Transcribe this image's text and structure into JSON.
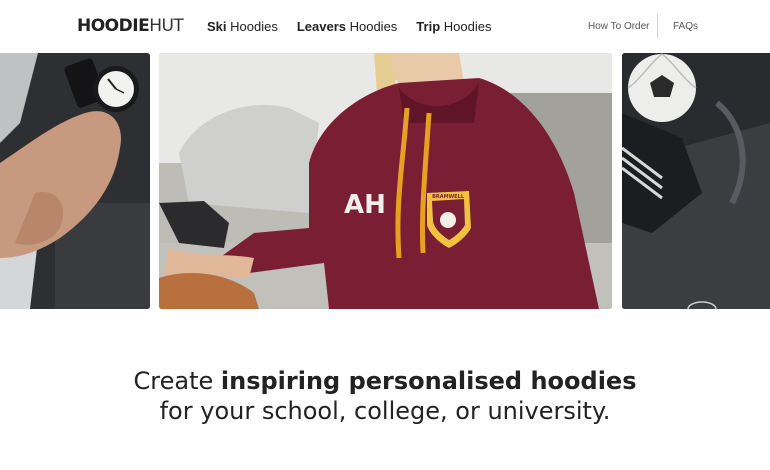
{
  "brand": {
    "logo_bold": "HOODIE",
    "logo_light": "HUT"
  },
  "nav": {
    "items": [
      {
        "bold": "Ski",
        "rest": " Hoodies"
      },
      {
        "bold": "Leavers",
        "rest": " Hoodies"
      },
      {
        "bold": "Trip",
        "rest": " Hoodies"
      }
    ]
  },
  "secondary_nav": {
    "how_to_order": "How To Order",
    "faqs": "FAQs"
  },
  "gallery": {
    "center_image": {
      "hoodie_letters": "AH",
      "crest_text": "BRAMWELL"
    }
  },
  "hero": {
    "line1_pre": "Create ",
    "line1_bold": "inspiring personalised hoodies",
    "line2": "for your school, college, or university."
  },
  "colors": {
    "hoodie": "#7a1f33",
    "drawstring": "#e6a21f",
    "accent_text": "#222222"
  }
}
